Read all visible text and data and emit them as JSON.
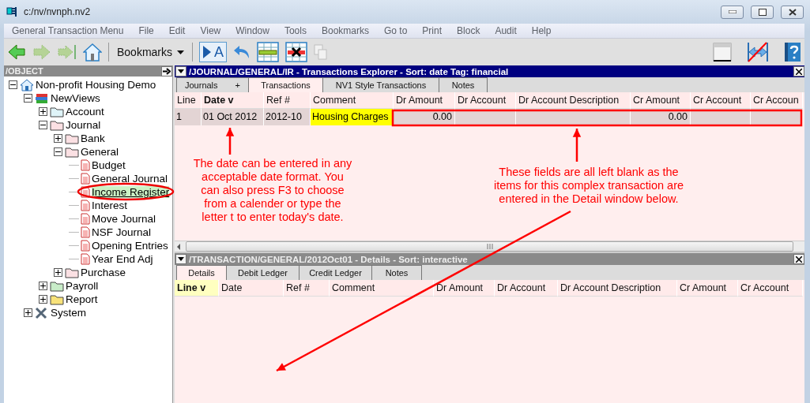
{
  "window": {
    "title": "c:/nv/nvnph.nv2"
  },
  "menu": [
    "General Transaction Menu",
    "File",
    "Edit",
    "View",
    "Window",
    "Tools",
    "Bookmarks",
    "Go to",
    "Print",
    "Block",
    "Audit",
    "Help"
  ],
  "toolbar": {
    "bookmarks": "Bookmarks",
    "edit_letter": "A"
  },
  "object_panel": {
    "title": "/OBJECT",
    "tree": [
      {
        "label": "Non-profit Housing Demo",
        "kind": "root",
        "expanded": true,
        "selected": false,
        "children": [
          {
            "label": "NewViews",
            "kind": "books",
            "expanded": true,
            "selected": false,
            "children": [
              {
                "label": "Account",
                "kind": "folder",
                "color": "#dff4f8",
                "expanded": false,
                "selected": false
              },
              {
                "label": "Journal",
                "kind": "folder",
                "color": "#fbe0e3",
                "expanded": true,
                "selected": false,
                "children": [
                  {
                    "label": "Bank",
                    "kind": "folder",
                    "color": "#fbe0e3",
                    "expanded": false,
                    "selected": false
                  },
                  {
                    "label": "General",
                    "kind": "folder",
                    "color": "#fbe0e3",
                    "expanded": true,
                    "selected": false,
                    "children": [
                      {
                        "label": "Budget",
                        "kind": "document",
                        "selected": false
                      },
                      {
                        "label": "General Journal",
                        "kind": "document",
                        "selected": false
                      },
                      {
                        "label": "Income Register",
                        "kind": "document",
                        "selected": true
                      },
                      {
                        "label": "Interest",
                        "kind": "document",
                        "selected": false
                      },
                      {
                        "label": "Move Journal",
                        "kind": "document",
                        "selected": false
                      },
                      {
                        "label": "NSF Journal",
                        "kind": "document",
                        "selected": false
                      },
                      {
                        "label": "Opening Entries",
                        "kind": "document",
                        "selected": false
                      },
                      {
                        "label": "Year End Adj",
                        "kind": "document",
                        "selected": false
                      }
                    ]
                  },
                  {
                    "label": "Purchase",
                    "kind": "folder",
                    "color": "#fbe0e3",
                    "expanded": false,
                    "selected": false
                  }
                ]
              },
              {
                "label": "Payroll",
                "kind": "folder",
                "color": "#c8ecc8",
                "expanded": false,
                "selected": false
              },
              {
                "label": "Report",
                "kind": "folder",
                "color": "#f8e27a",
                "expanded": false,
                "selected": false
              }
            ]
          },
          {
            "label": "System",
            "kind": "tools",
            "expanded": false,
            "selected": false
          }
        ]
      }
    ]
  },
  "transactions_pane": {
    "title": "/JOURNAL/GENERAL/IR - Transactions Explorer - Sort: date  Tag: financial",
    "tabs": [
      {
        "label": "Journals",
        "extra": "+",
        "selected": false
      },
      {
        "label": "Transactions",
        "selected": true
      },
      {
        "label": "NV1 Style Transactions",
        "selected": false
      },
      {
        "label": "Notes",
        "selected": false
      }
    ],
    "columns": [
      {
        "label": "Line"
      },
      {
        "label": "Date",
        "sort_mark": "v"
      },
      {
        "label": "Ref #"
      },
      {
        "label": "Comment"
      },
      {
        "label": "Dr Amount"
      },
      {
        "label": "Dr Account"
      },
      {
        "label": "Dr Account Description"
      },
      {
        "label": "Cr Amount"
      },
      {
        "label": "Cr Account"
      },
      {
        "label": "Cr Accoun"
      }
    ],
    "rows": [
      {
        "line": "1",
        "date": "01 Oct 2012",
        "ref": "2012-10",
        "comment": "Housing Charges",
        "dr_amount": "0.00",
        "cr_amount": "0.00"
      }
    ]
  },
  "details_pane": {
    "title": "/TRANSACTION/GENERAL/2012Oct01 - Details - Sort: interactive",
    "tabs": [
      {
        "label": "Details",
        "selected": true
      },
      {
        "label": "Debit Ledger",
        "selected": false
      },
      {
        "label": "Credit Ledger",
        "selected": false
      },
      {
        "label": "Notes",
        "selected": false
      }
    ],
    "columns": [
      {
        "label": "Line",
        "sort_mark": "v"
      },
      {
        "label": "Date"
      },
      {
        "label": "Ref #"
      },
      {
        "label": "Comment"
      },
      {
        "label": "Dr Amount"
      },
      {
        "label": "Dr Account"
      },
      {
        "label": "Dr Account Description"
      },
      {
        "label": "Cr Amount"
      },
      {
        "label": "Cr Account"
      }
    ]
  },
  "annotations": [
    {
      "text": "The date can be entered in any\nacceptable date format. You\ncan also press F3 to choose\nfrom a calender or type the\nletter t to enter today's date."
    },
    {
      "text": "These fields are all left blank as the\nitems for this complex transaction are\nentered in the Detail window below."
    }
  ]
}
